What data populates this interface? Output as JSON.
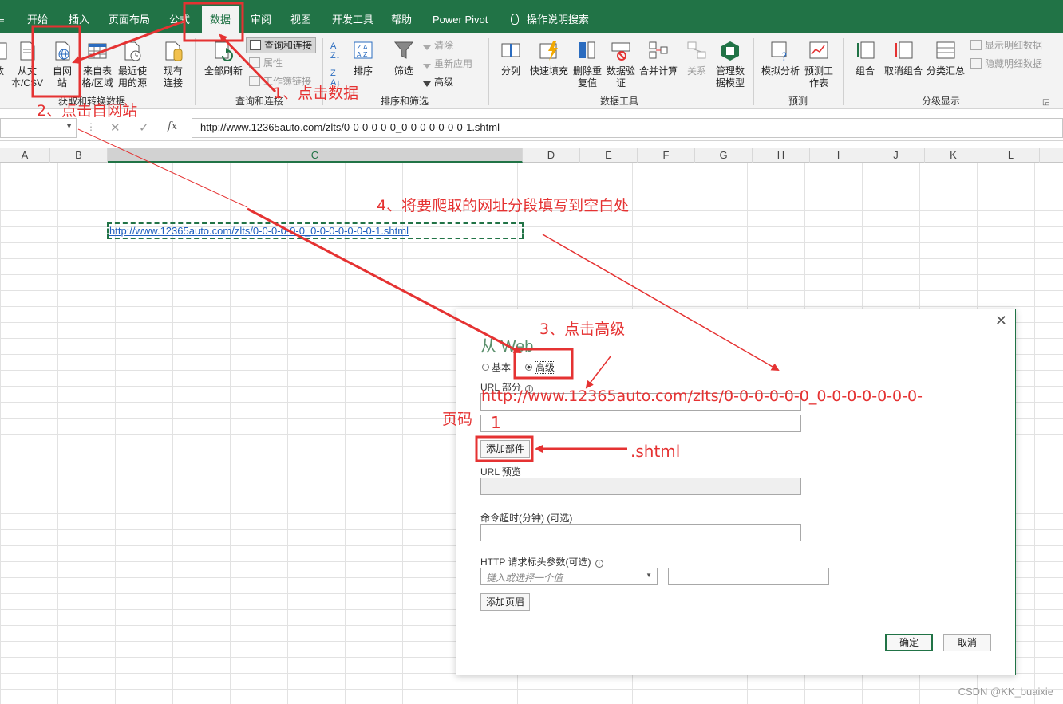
{
  "tabs": [
    "开始",
    "插入",
    "页面布局",
    "公式",
    "数据",
    "审阅",
    "视图",
    "开发工具",
    "帮助",
    "Power Pivot",
    "操作说明搜索"
  ],
  "ribbon": {
    "get_data": {
      "btn1": "数",
      "from_text": "从文本/CSV",
      "from_web": "自网站",
      "from_table": "来自表格/区域",
      "recent": "最近使用的源",
      "existing": "现有连接",
      "label": "获取和转换数据"
    },
    "queries": {
      "refresh_all": "全部刷新",
      "queries_conn": "查询和连接",
      "properties": "属性",
      "edit_links": "工作簿链接",
      "label": "查询和连接"
    },
    "sort_filter": {
      "sort": "排序",
      "filter": "筛选",
      "clear": "清除",
      "reapply": "重新应用",
      "advanced": "高级",
      "label": "排序和筛选"
    },
    "data_tools": {
      "split": "分列",
      "flash_fill": "快速填充",
      "remove_dup": "删除重复值",
      "validation": "数据验证",
      "consolidate": "合并计算",
      "relations": "关系",
      "manage_model": "管理数据模型",
      "label": "数据工具"
    },
    "forecast": {
      "what_if": "模拟分析",
      "forecast_sheet": "预测工作表",
      "label": "预测"
    },
    "outline": {
      "group": "组合",
      "ungroup": "取消组合",
      "subtotal": "分类汇总",
      "show_detail": "显示明细数据",
      "hide_detail": "隐藏明细数据",
      "label": "分级显示"
    }
  },
  "formula_bar": {
    "fx": "fx",
    "value": "http://www.12365auto.com/zlts/0-0-0-0-0-0_0-0-0-0-0-0-0-1.shtml"
  },
  "columns": [
    "A",
    "B",
    "C",
    "D",
    "E",
    "F",
    "G",
    "H",
    "I",
    "J",
    "K",
    "L"
  ],
  "cell_C": "http://www.12365auto.com/zlts/0-0-0-0-0-0_0-0-0-0-0-0-0-1.shtml",
  "dialog": {
    "title": "从 Web",
    "basic": "基本",
    "advanced": "高级",
    "url_parts_label": "URL 部分",
    "add_part": "添加部件",
    "url_preview_label": "URL 预览",
    "timeout_label": "命令超时(分钟) (可选)",
    "http_label": "HTTP 请求标头参数(可选)",
    "http_placeholder": "键入或选择一个值",
    "add_header": "添加页眉",
    "ok": "确定",
    "cancel": "取消"
  },
  "annotations": {
    "step1": "1、点击数据",
    "step2": "2、点击自网站",
    "step3": "3、点击高级",
    "step4": "4、将要爬取的网址分段填写到空白处",
    "url_part1": "http://www.12365auto.com/zlts/0-0-0-0-0-0_0-0-0-0-0-0-0-",
    "page_num": "1",
    "page_label": "页码",
    "shtml": ".shtml"
  },
  "watermark": "CSDN @KK_buaixie",
  "colors": {
    "excel_green": "#217346",
    "annotation_red": "#e53232"
  }
}
